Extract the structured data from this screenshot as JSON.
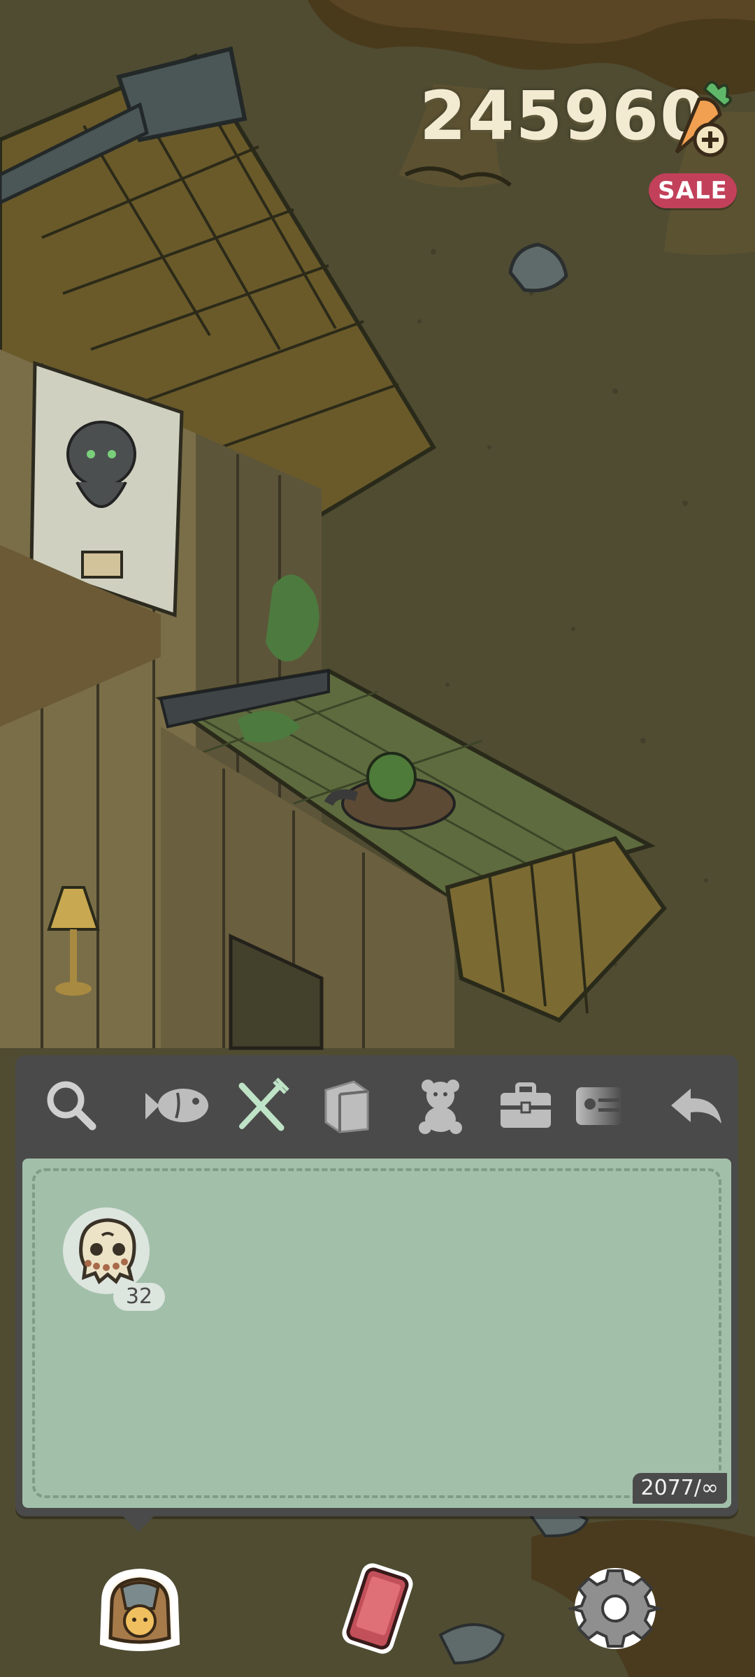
{
  "hud": {
    "currency_amount": "245960",
    "currency_icon": "carrot-plus-icon",
    "sale_label": "SALE",
    "sale_color": "#c2405a"
  },
  "toolbar": {
    "tabs": [
      {
        "icon": "magnifier-icon",
        "active": false
      },
      {
        "icon": "fish-icon",
        "active": false
      },
      {
        "icon": "fork-knife-icon",
        "active": true
      },
      {
        "icon": "book-icon",
        "active": false
      },
      {
        "icon": "teddy-bear-icon",
        "active": false
      },
      {
        "icon": "toolbox-icon",
        "active": false
      },
      {
        "icon": "ticket-icon",
        "active": false
      }
    ],
    "back_icon": "back-arrow-icon",
    "active_color": "#bfe3c6"
  },
  "inventory": {
    "items": [
      {
        "icon": "bone-skull-treat-icon",
        "count": "32"
      }
    ],
    "capacity": "2077/∞",
    "panel_color": "#a2bfaa"
  },
  "bottom_nav": {
    "items": [
      {
        "icon": "backpack-cat-icon"
      },
      {
        "icon": "phone-icon"
      },
      {
        "icon": "gear-icon"
      }
    ]
  }
}
